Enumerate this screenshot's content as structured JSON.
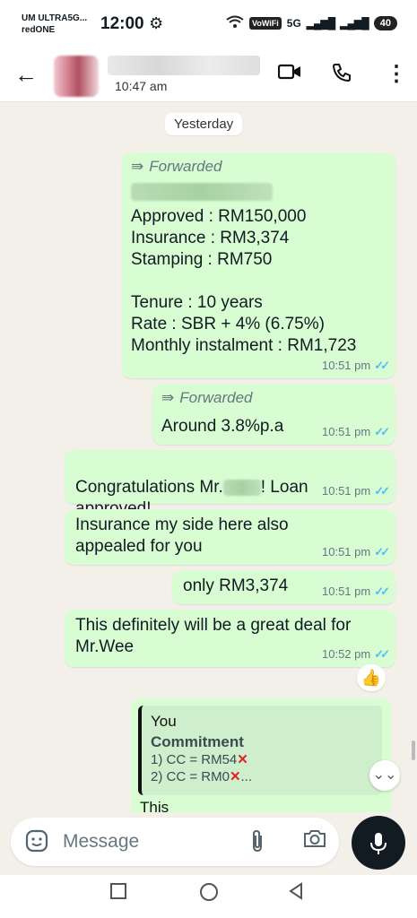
{
  "status_bar": {
    "carrier_line1": "UM ULTRA5G...",
    "carrier_line2": "redONE",
    "time": "12:00",
    "vowifi": "VoWiFi",
    "network": "5G",
    "battery": "40"
  },
  "header": {
    "last_seen": "10:47 am"
  },
  "chat": {
    "date_chip": "Yesterday",
    "forwarded_label": "Forwarded",
    "messages": [
      {
        "text": "Approved : RM150,000\nInsurance : RM3,374\nStamping : RM750\n\nTenure : 10 years\nRate : SBR + 4% (6.75%)\nMonthly instalment : RM1,723",
        "time": "10:51 pm"
      },
      {
        "text": "Around 3.8%p.a",
        "time": "10:51 pm"
      },
      {
        "text_before": "Congratulations Mr.",
        "text_after": "! Loan approved!",
        "time": "10:51 pm"
      },
      {
        "text": "Insurance my side here also appealed for you",
        "time": "10:51 pm"
      },
      {
        "text": "only RM3,374",
        "time": "10:51 pm"
      },
      {
        "text": "This definitely will be a great deal for Mr.Wee",
        "time": "10:52 pm"
      }
    ],
    "reaction": "👍",
    "reply_quote": {
      "author": "You",
      "title": "Commitment",
      "line1": "1) CC = RM54",
      "line2": "2) CC = RM0",
      "line2_suffix": "...",
      "continuation": "This"
    }
  },
  "input": {
    "placeholder": "Message"
  },
  "colors": {
    "bubble_out": "#d9fdd3",
    "chat_bg": "#f3f0e9",
    "tick": "#53bdeb",
    "mic_button": "#111b21"
  }
}
